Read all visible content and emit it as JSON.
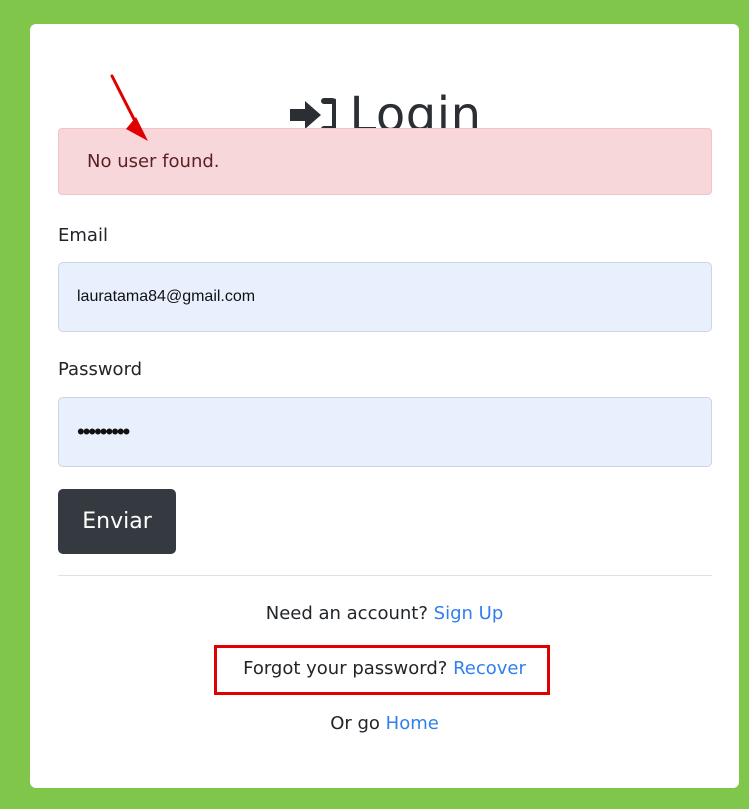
{
  "page": {
    "title": "Login",
    "error_message": "No user found.",
    "email_label": "Email",
    "email_value": "lauratama84@gmail.com",
    "password_label": "Password",
    "password_value": "•••••••••",
    "submit_button": "Enviar",
    "signup_prefix": "Need an account?",
    "signup_link": "Sign Up",
    "recover_prefix": "Forgot your password?",
    "recover_link": "Recover",
    "home_prefix": "Or go",
    "home_link": "Home"
  },
  "icons": {
    "title_icon": "login-icon",
    "annotation_arrow": "red-arrow-icon"
  },
  "colors": {
    "background": "#7fc64a",
    "card": "#ffffff",
    "alert_background": "#f8d7da",
    "alert_border": "#f5c2c7",
    "input_background": "#e8f0fe",
    "button_background": "#343a40",
    "link": "#2f80ed",
    "annotation": "#e10000"
  }
}
